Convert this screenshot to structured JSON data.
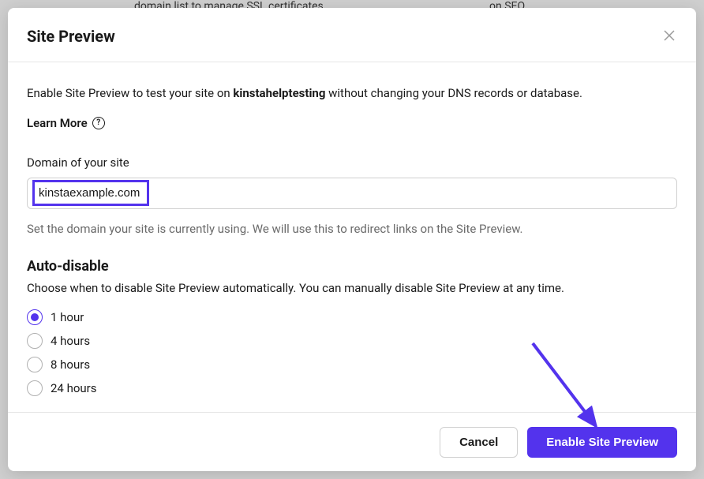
{
  "modal": {
    "title": "Site Preview",
    "intro_prefix": "Enable Site Preview to test your site on ",
    "intro_site": "kinstahelptesting",
    "intro_suffix": " without changing your DNS records or database.",
    "learn_more": "Learn More",
    "domain_label": "Domain of your site",
    "domain_value": "kinstaexample.com",
    "domain_helper": "Set the domain your site is currently using. We will use this to redirect links on the Site Preview.",
    "auto_disable_title": "Auto-disable",
    "auto_disable_desc": "Choose when to disable Site Preview automatically. You can manually disable Site Preview at any time.",
    "radio_options": [
      {
        "label": "1 hour",
        "selected": true
      },
      {
        "label": "4 hours",
        "selected": false
      },
      {
        "label": "8 hours",
        "selected": false
      },
      {
        "label": "24 hours",
        "selected": false
      }
    ],
    "cancel_label": "Cancel",
    "submit_label": "Enable Site Preview"
  },
  "colors": {
    "accent": "#5333ed"
  }
}
